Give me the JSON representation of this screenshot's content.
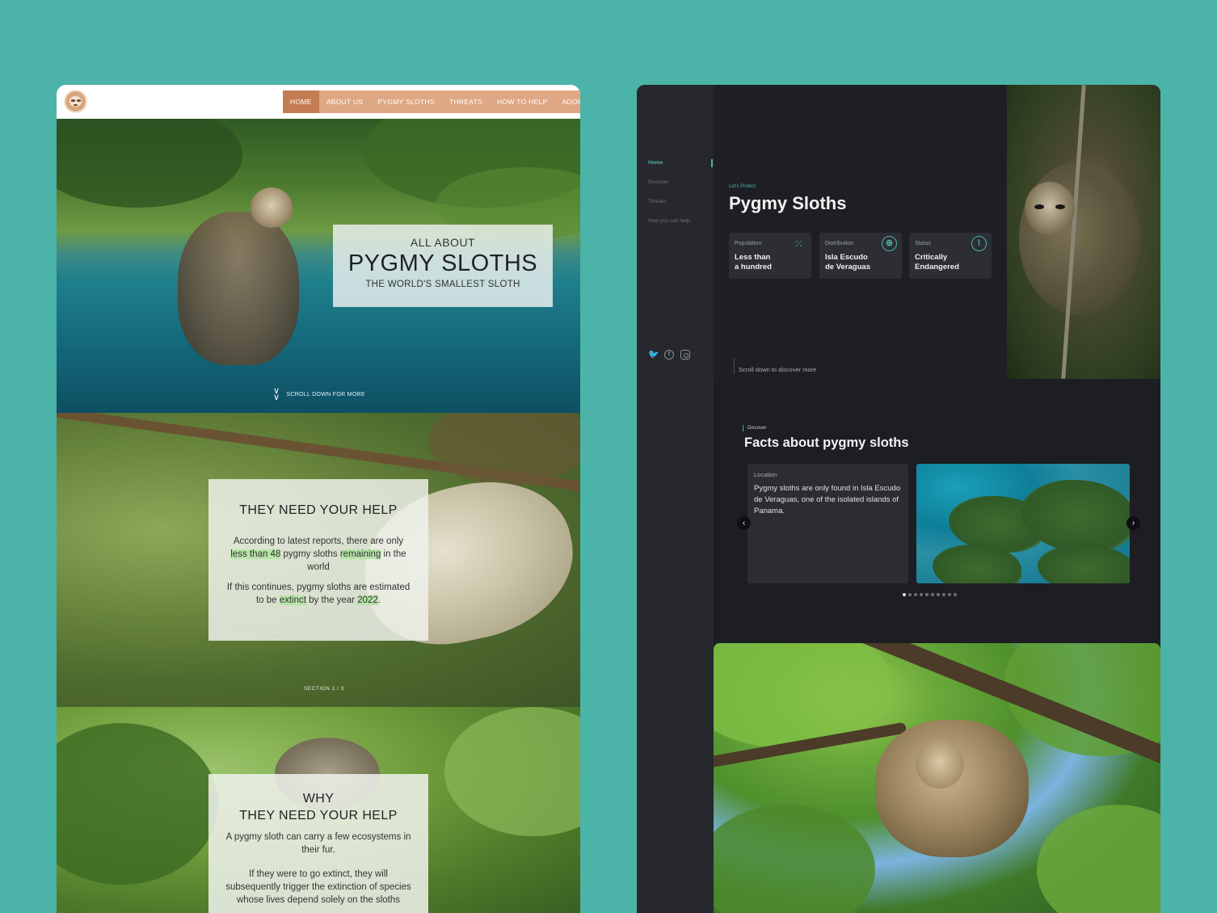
{
  "left": {
    "nav": {
      "logo_icon": "sloth-face-logo",
      "items": [
        "HOME",
        "ABOUT US",
        "PYGMY SLOTHS",
        "THREATS",
        "HOW TO HELP",
        "ADOPTION"
      ],
      "active_index": 0
    },
    "hero": {
      "kicker": "ALL ABOUT",
      "title": "PYGMY SLOTHS",
      "subtitle": "THE WORLD'S SMALLEST SLOTH",
      "scroll_label": "SCROLL DOWN FOR MORE",
      "scroll_icon": "double-chevron-down-icon"
    },
    "section_help": {
      "title": "THEY NEED YOUR HELP",
      "p1_a": "According to latest reports, there are only ",
      "p1_hl1": "less than 48",
      "p1_b": " pygmy sloths ",
      "p1_hl2": "remaining",
      "p1_c": " in the world",
      "p2_a": "If this continues, pygmy sloths are estimated to be ",
      "p2_hl1": "extinct",
      "p2_b": " by the year ",
      "p2_hl2": "2022",
      "p2_c": ".",
      "counter": "SECTION 1 / 3"
    },
    "section_why": {
      "title_line1": "WHY",
      "title_line2": "THEY NEED YOUR HELP",
      "p1": "A pygmy sloth can carry a few ecosystems in their fur.",
      "p2": "If they were to go extinct, they will subsequently trigger the extinction of species whose lives depend solely on the sloths"
    }
  },
  "right": {
    "sidebar": {
      "items": [
        "Home",
        "Discover",
        "Threats",
        "How you can help"
      ],
      "active_index": 0,
      "social_icons": [
        "twitter-icon",
        "facebook-icon",
        "instagram-icon"
      ]
    },
    "hero": {
      "kicker": "Let's Protect",
      "title": "Pygmy Sloths",
      "scroll_hint": "Scroll down to discover more"
    },
    "stats": [
      {
        "label": "Population",
        "value_line1": "Less than",
        "value_line2": "a hundred",
        "icon": "paw-icon"
      },
      {
        "label": "Distribution",
        "value_line1": "Isla Escudo",
        "value_line2": "de Veraguas",
        "icon": "globe-icon"
      },
      {
        "label": "Status",
        "value_line1": "Critically",
        "value_line2": "Endangered",
        "icon": "alert-circle-icon"
      }
    ],
    "discover": {
      "tag": "Discover",
      "title": "Facts about pygmy sloths",
      "card_label": "Location",
      "card_text": "Pygmy sloths are only found in Isla Escudo de Veraguas, one of the isolated islands of Panama.",
      "prev_icon": "chevron-left-icon",
      "next_icon": "chevron-right-icon",
      "slide_count": 10,
      "active_slide": 0
    }
  },
  "colors": {
    "background": "#4bb3a7",
    "accent_left": "#dfa784",
    "accent_left_active": "#c47d52",
    "accent_right": "#4bb3a7",
    "dark_bg": "#1d1e23",
    "highlight": "#b7e4a8"
  }
}
